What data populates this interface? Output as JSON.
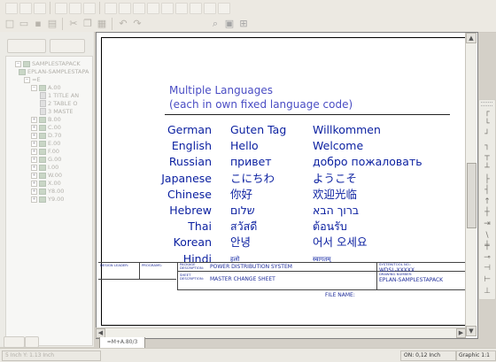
{
  "left_panel": {
    "buttons": [
      "",
      ""
    ],
    "tree": [
      {
        "indent": 10,
        "exp": "−",
        "icon": "proj",
        "text": "SAMPLESTAPACK"
      },
      {
        "indent": 14,
        "exp": "",
        "icon": "proj",
        "text": "EPLAN-SAMPLESTAPA"
      },
      {
        "indent": 20,
        "exp": "−",
        "icon": "",
        "text": "=E"
      },
      {
        "indent": 28,
        "exp": "−",
        "icon": "folder",
        "text": "A.00"
      },
      {
        "indent": 38,
        "exp": "",
        "icon": "page",
        "text": "1 TITLE AN"
      },
      {
        "indent": 38,
        "exp": "",
        "icon": "page",
        "text": "2 TABLE O"
      },
      {
        "indent": 38,
        "exp": "",
        "icon": "page",
        "text": "3 MASTE"
      },
      {
        "indent": 28,
        "exp": "+",
        "icon": "folder",
        "text": "B.00"
      },
      {
        "indent": 28,
        "exp": "+",
        "icon": "folder",
        "text": "C.00"
      },
      {
        "indent": 28,
        "exp": "+",
        "icon": "folder",
        "text": "D.70"
      },
      {
        "indent": 28,
        "exp": "+",
        "icon": "folder",
        "text": "E.00"
      },
      {
        "indent": 28,
        "exp": "+",
        "icon": "folder",
        "text": "F.00"
      },
      {
        "indent": 28,
        "exp": "+",
        "icon": "folder",
        "text": "G.00"
      },
      {
        "indent": 28,
        "exp": "+",
        "icon": "folder",
        "text": "I.00"
      },
      {
        "indent": 28,
        "exp": "+",
        "icon": "folder",
        "text": "W.00"
      },
      {
        "indent": 28,
        "exp": "+",
        "icon": "folder",
        "text": "X.00"
      },
      {
        "indent": 28,
        "exp": "+",
        "icon": "folder",
        "text": "Y8.00"
      },
      {
        "indent": 28,
        "exp": "+",
        "icon": "folder",
        "text": "Y9.00"
      }
    ],
    "bottom_buttons": [
      "",
      ""
    ]
  },
  "sheet": {
    "title_line1": "Multiple Languages",
    "title_line2": "(each in own fixed language code)",
    "rows": [
      {
        "lang": "German",
        "hello": "Guten Tag",
        "welcome": "Willkommen"
      },
      {
        "lang": "English",
        "hello": "Hello",
        "welcome": "Welcome"
      },
      {
        "lang": "Russian",
        "hello": "привет",
        "welcome": "добро пожаловать"
      },
      {
        "lang": "Japanese",
        "hello": "こにちわ",
        "welcome": "ようこそ"
      },
      {
        "lang": "Chinese",
        "hello": "你好",
        "welcome": "欢迎光临"
      },
      {
        "lang": "Hebrew",
        "hello": "שלום",
        "welcome": "ברוך הבא"
      },
      {
        "lang": "Thai",
        "hello": "สวัสดี",
        "welcome": "ต้อนรับ"
      },
      {
        "lang": "Korean",
        "hello": "안녕",
        "welcome": "어서 오세요"
      },
      {
        "lang": "Hindi",
        "hello": "हलो",
        "welcome": "स्वागतम्"
      }
    ]
  },
  "title_block": {
    "design_leader_label": "DESIGN LEADER:",
    "programs_label": "PROGRAMS:",
    "package_label_1": "PACKAGE",
    "package_label_2": "DESCRIPTION:",
    "package_value": "POWER DISTRIBUTION SYSTEM",
    "sheet_label_1": "SHEET",
    "sheet_label_2": "DESCRIPTION:",
    "sheet_value": "MASTER CHANGE SHEET",
    "system_label": "SYSTEM/TOOL NO.:",
    "system_value": "WDSL-XXXXX",
    "drawing_label": "DRAWING NUMBER:",
    "drawing_value": "EPLAN-SAMPLESTAPACK",
    "file_name_label": "FILE NAME:"
  },
  "page_tab": "=M+A.80/3",
  "right_toolbar": [
    "┌",
    "└",
    "┘",
    "┐",
    "┬",
    "┴",
    "├",
    "┤",
    "↑",
    "┼",
    "⇥",
    "\\",
    "╪",
    "⊸",
    "⊣",
    "⊢",
    "⊥"
  ],
  "status": {
    "coords": "5 Inch  Y: 1.13 Inch",
    "grid": "ON: 0,12 Inch",
    "mode": "Graphic 1:1"
  }
}
